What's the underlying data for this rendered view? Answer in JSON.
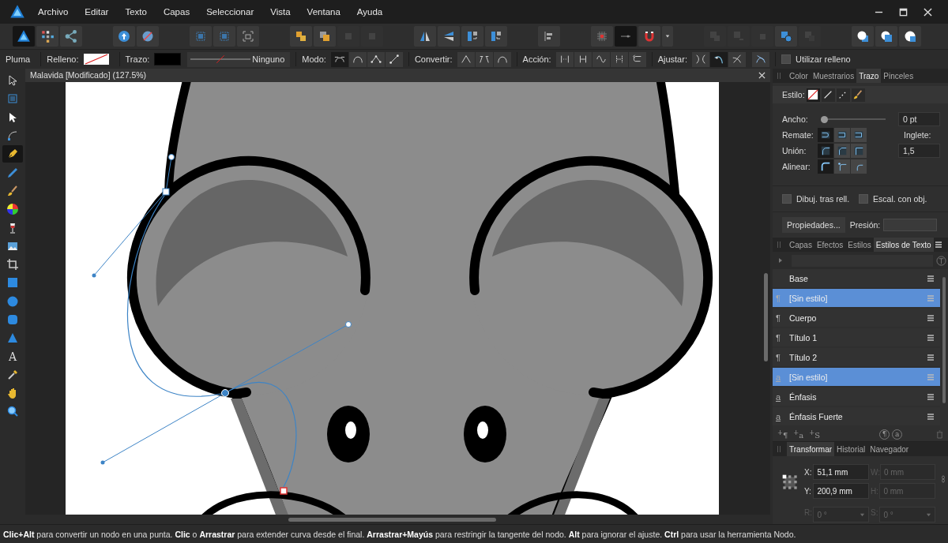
{
  "menu": [
    "Archivo",
    "Editar",
    "Texto",
    "Capas",
    "Seleccionar",
    "Vista",
    "Ventana",
    "Ayuda"
  ],
  "personas": [
    {
      "kind": "designer",
      "selected": true
    },
    {
      "kind": "pixel",
      "selected": false
    },
    {
      "kind": "export",
      "selected": false
    }
  ],
  "toolbar": [
    [
      {
        "kind": "upload",
        "disabled": false,
        "selected": false
      },
      {
        "kind": "flower_slash",
        "disabled": false,
        "selected": false
      }
    ],
    [
      {
        "kind": "select_grid",
        "disabled": false,
        "selected": false
      },
      {
        "kind": "select_grid",
        "disabled": false,
        "selected": false
      },
      {
        "kind": "select_corners",
        "disabled": false,
        "selected": false
      }
    ],
    [
      {
        "kind": "stack_back",
        "disabled": false,
        "selected": false
      },
      {
        "kind": "stack_front",
        "disabled": false,
        "selected": false
      },
      {
        "kind": "square",
        "disabled": true,
        "selected": false
      },
      {
        "kind": "square",
        "disabled": true,
        "selected": false
      }
    ],
    [
      {
        "kind": "flip_h",
        "disabled": false,
        "selected": false
      },
      {
        "kind": "flip_v",
        "disabled": false,
        "selected": false
      },
      {
        "kind": "rotate_ccw",
        "disabled": false,
        "selected": false
      },
      {
        "kind": "rotate_cw",
        "disabled": false,
        "selected": false
      }
    ],
    [
      {
        "kind": "align",
        "disabled": false,
        "selected": false
      }
    ],
    [
      {
        "kind": "grid",
        "disabled": false,
        "selected": false
      },
      {
        "kind": "snap_line",
        "disabled": false,
        "selected": true
      },
      {
        "kind": "magnet",
        "disabled": false,
        "selected": false
      },
      {
        "kind": "caret",
        "disabled": false,
        "selected": false
      }
    ],
    [
      {
        "kind": "bool_add",
        "disabled": true,
        "selected": false
      },
      {
        "kind": "bool_sub",
        "disabled": true,
        "selected": false
      },
      {
        "kind": "bool_int",
        "disabled": true,
        "selected": false
      },
      {
        "kind": "bool_div",
        "disabled": false,
        "selected": false
      },
      {
        "kind": "bool_comb",
        "disabled": true,
        "selected": false
      }
    ],
    [
      {
        "kind": "circle_square",
        "disabled": false,
        "selected": false
      },
      {
        "kind": "square_circle",
        "disabled": false,
        "selected": false
      },
      {
        "kind": "circle_cut",
        "disabled": false,
        "selected": false
      }
    ]
  ],
  "context": {
    "tool": "Pluma",
    "fill_label": "Relleno:",
    "stroke_label": "Trazo:",
    "stroke_style": "Ninguno",
    "mode_label": "Modo:",
    "modes": [
      {
        "kind": "smart",
        "selected": true
      },
      {
        "kind": "pen",
        "selected": false
      },
      {
        "kind": "polygon",
        "selected": false
      },
      {
        "kind": "line",
        "selected": false
      }
    ],
    "convert_label": "Convertir:",
    "convert": [
      {
        "kind": "sharp"
      },
      {
        "kind": "smooth"
      },
      {
        "kind": "arch"
      }
    ],
    "action_label": "Acción:",
    "actions": [
      {
        "kind": "break"
      },
      {
        "kind": "close"
      },
      {
        "kind": "wave"
      },
      {
        "kind": "join"
      },
      {
        "kind": "reverse"
      }
    ],
    "snap_label": "Ajustar:",
    "snap": [
      {
        "kind": "split",
        "selected": false
      },
      {
        "kind": "curve",
        "selected": true
      },
      {
        "kind": "cross",
        "selected": false
      }
    ],
    "extra": {
      "kind": "tangent"
    },
    "use_fill": {
      "label": "Utilizar relleno",
      "checked": false
    }
  },
  "document": {
    "title": "Malavida [Modificado] (127.5%)"
  },
  "tools": [
    {
      "kind": "move",
      "selected": false
    },
    {
      "kind": "artboard",
      "selected": false
    },
    {
      "kind": "node",
      "selected": false
    },
    {
      "kind": "corner",
      "selected": false
    },
    {
      "kind": "pen",
      "selected": true
    },
    {
      "kind": "pencil",
      "selected": false
    },
    {
      "kind": "brush",
      "selected": false
    },
    {
      "kind": "fill",
      "selected": false
    },
    {
      "kind": "transparency",
      "selected": false
    },
    {
      "kind": "place",
      "selected": false
    },
    {
      "kind": "crop",
      "selected": false
    },
    {
      "kind": "rectangle",
      "selected": false
    },
    {
      "kind": "ellipse",
      "selected": false
    },
    {
      "kind": "rounded_rectangle",
      "selected": false
    },
    {
      "kind": "triangle",
      "selected": false
    },
    {
      "kind": "text",
      "glyph": "A",
      "selected": false
    },
    {
      "kind": "eyedropper",
      "selected": false
    },
    {
      "kind": "hand",
      "selected": false
    },
    {
      "kind": "zoom",
      "selected": false
    }
  ],
  "stroke_panel": {
    "tabs": [
      {
        "label": "Color",
        "selected": false
      },
      {
        "label": "Muestrarios",
        "selected": false
      },
      {
        "label": "Trazo",
        "selected": true
      },
      {
        "label": "Pinceles",
        "selected": false
      }
    ],
    "style_label": "Estilo:",
    "styles": [
      {
        "kind": "none",
        "selected": true
      },
      {
        "kind": "solid",
        "selected": false
      },
      {
        "kind": "dashed",
        "selected": false
      },
      {
        "kind": "brush",
        "selected": false
      }
    ],
    "width_label": "Ancho:",
    "width": {
      "level": 0,
      "value": "0 pt"
    },
    "cap_label": "Remate:",
    "caps": [
      {
        "kind": "round",
        "selected": true
      },
      {
        "kind": "square",
        "selected": false
      },
      {
        "kind": "butt",
        "selected": false
      }
    ],
    "miter_label": "Inglete:",
    "miter": "1,5",
    "join_label": "Unión:",
    "joins": [
      {
        "kind": "round",
        "selected": true
      },
      {
        "kind": "bevel",
        "selected": false
      },
      {
        "kind": "miter",
        "selected": false
      }
    ],
    "align_label": "Alinear:",
    "aligns": [
      {
        "kind": "outside",
        "selected": true
      },
      {
        "kind": "center",
        "selected": false
      },
      {
        "kind": "inside",
        "selected": false
      }
    ],
    "options": [
      {
        "label": "Dibuj. tras rell.",
        "checked": false
      },
      {
        "label": "Escal. con obj.",
        "checked": false
      }
    ],
    "properties_button": "Propiedades...",
    "pressure_label": "Presión:"
  },
  "text_styles": {
    "tabs": [
      {
        "label": "Capas",
        "selected": false
      },
      {
        "label": "Efectos",
        "selected": false
      },
      {
        "label": "Estilos",
        "selected": false
      },
      {
        "label": "Estilos de Texto",
        "selected": true
      }
    ],
    "items": [
      {
        "kind": "group",
        "name": "Base",
        "selected": false
      },
      {
        "kind": "paragraph",
        "icon": "¶",
        "name": "[Sin estilo]",
        "selected": true
      },
      {
        "kind": "paragraph",
        "icon": "¶",
        "name": "Cuerpo",
        "selected": false
      },
      {
        "kind": "paragraph",
        "icon": "¶",
        "name": "Título 1",
        "selected": false
      },
      {
        "kind": "paragraph",
        "icon": "¶",
        "name": "Título 2",
        "selected": false
      },
      {
        "kind": "character",
        "icon": "a",
        "name": "[Sin estilo]",
        "selected": true
      },
      {
        "kind": "character",
        "icon": "a",
        "name": "Énfasis",
        "selected": false
      },
      {
        "kind": "character",
        "icon": "a",
        "name": "Énfasis Fuerte",
        "selected": false
      }
    ],
    "footer": [
      {
        "kind": "add",
        "glyph": "$^{+}$¶"
      },
      {
        "kind": "add",
        "glyph": "$^{+}$a"
      },
      {
        "kind": "add",
        "glyph": "$^{+}$S"
      },
      {
        "kind": "circled",
        "glyph": "¶"
      },
      {
        "kind": "circled",
        "glyph": "a"
      }
    ]
  },
  "transform": {
    "tabs": [
      {
        "label": "Transformar",
        "selected": true
      },
      {
        "label": "Historial",
        "selected": false
      },
      {
        "label": "Navegador",
        "selected": false
      }
    ],
    "fields": [
      {
        "label": "X:",
        "value": "51,1 mm",
        "disabled": false
      },
      {
        "label": "W:",
        "value": "0 mm",
        "disabled": true
      },
      {
        "label": "Y:",
        "value": "200,9 mm",
        "disabled": false
      },
      {
        "label": "H:",
        "value": "0 mm",
        "disabled": true
      },
      {
        "label": "R:",
        "value": "0 °",
        "disabled": true
      },
      {
        "label": "S:",
        "value": "0 °",
        "disabled": true
      }
    ]
  },
  "status": "**Clic+Alt** para convertir un nodo en una punta. **Clic** o **Arrastrar** para extender curva desde el final. **Arrastrar+Mayús** para restringir la tangente del nodo. **Alt** para ignorar el ajuste. **Ctrl** para usar la herramienta Nodo."
}
